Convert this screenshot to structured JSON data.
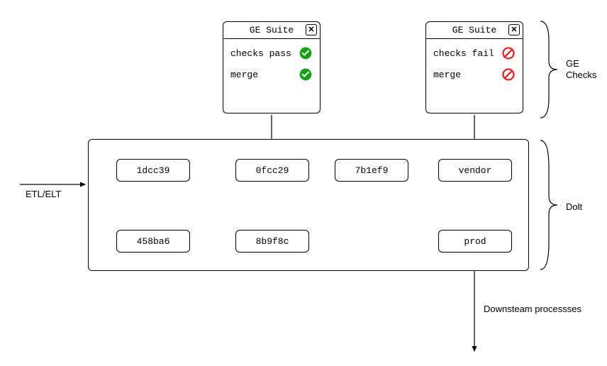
{
  "ge_suite_pass": {
    "title": "GE Suite",
    "row1": "checks pass",
    "row2": "merge"
  },
  "ge_suite_fail": {
    "title": "GE Suite",
    "row1": "checks fail",
    "row2": "merge"
  },
  "labels": {
    "etl": "ETL/ELT",
    "ge_checks_line1": "GE",
    "ge_checks_line2": "Checks",
    "dolt": "Dolt",
    "downstream": "Downsteam processses"
  },
  "nodes": {
    "n1": "1dcc39",
    "n2": "0fcc29",
    "n3": "7b1ef9",
    "n4": "vendor",
    "n5": "458ba6",
    "n6": "8b9f8c",
    "n7": "prod"
  }
}
